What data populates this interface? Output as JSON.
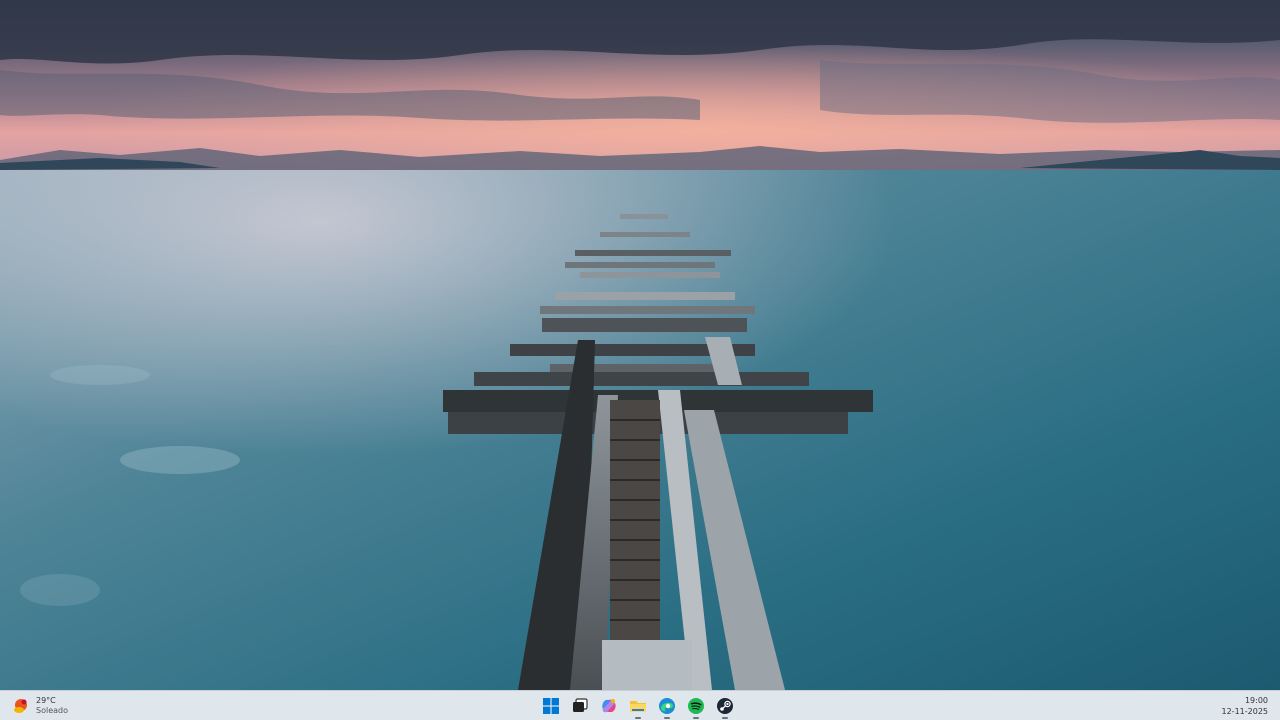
{
  "desktop": {
    "wallpaper": "lake-pier-sunset-wallpaper"
  },
  "taskbar": {
    "weather": {
      "temperature": "29°C",
      "condition": "Soleado",
      "icon": "sun-cloud-icon"
    },
    "apps": [
      {
        "name": "start",
        "icon": "windows-logo-icon"
      },
      {
        "name": "task-view",
        "icon": "task-view-icon"
      },
      {
        "name": "copilot",
        "icon": "copilot-icon"
      },
      {
        "name": "file-explorer",
        "icon": "folder-icon"
      },
      {
        "name": "edge",
        "icon": "edge-icon"
      },
      {
        "name": "spotify",
        "icon": "spotify-icon"
      },
      {
        "name": "steam",
        "icon": "steam-icon"
      }
    ],
    "clock": {
      "time": "19:00",
      "date": "12-11-2025"
    }
  },
  "colors": {
    "taskbar_bg": "#dfe6ec",
    "windows_blue": "#0078d4",
    "spotify_green": "#1db954"
  }
}
